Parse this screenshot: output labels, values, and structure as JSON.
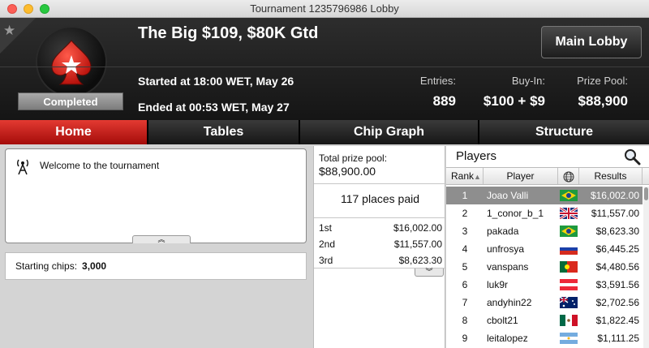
{
  "window": {
    "title": "Tournament 1235796986 Lobby"
  },
  "header": {
    "tournament_name": "The Big $109, $80K Gtd",
    "started": "Started at 18:00 WET, May 26",
    "ended": "Ended at 00:53 WET, May 27",
    "status": "Completed",
    "main_lobby": "Main Lobby",
    "entries": {
      "label": "Entries:",
      "value": "889"
    },
    "buyin": {
      "label": "Buy-In:",
      "value": "$100 + $9"
    },
    "prize_pool": {
      "label": "Prize Pool:",
      "value": "$88,900"
    }
  },
  "tabs": [
    "Home",
    "Tables",
    "Chip Graph",
    "Structure"
  ],
  "home": {
    "welcome": "Welcome to the tournament",
    "starting_chips_label": "Starting chips:",
    "starting_chips_value": "3,000"
  },
  "prize": {
    "total_label": "Total prize pool:",
    "total_value": "$88,900.00",
    "places_paid": "117 places paid",
    "payouts": [
      {
        "place": "1st",
        "amount": "$16,002.00"
      },
      {
        "place": "2nd",
        "amount": "$11,557.00"
      },
      {
        "place": "3rd",
        "amount": "$8,623.30"
      }
    ]
  },
  "players": {
    "title": "Players",
    "columns": {
      "rank": "Rank",
      "name": "Player",
      "results": "Results"
    },
    "rows": [
      {
        "rank": "1",
        "name": "Joao Valli",
        "flag": "brazil",
        "result": "$16,002.00"
      },
      {
        "rank": "2",
        "name": "1_conor_b_1",
        "flag": "uk",
        "result": "$11,557.00"
      },
      {
        "rank": "3",
        "name": "pakada",
        "flag": "brazil",
        "result": "$8,623.30"
      },
      {
        "rank": "4",
        "name": "unfrosya",
        "flag": "russia",
        "result": "$6,445.25"
      },
      {
        "rank": "5",
        "name": "vanspans",
        "flag": "portugal",
        "result": "$4,480.56"
      },
      {
        "rank": "6",
        "name": "luk9r",
        "flag": "austria",
        "result": "$3,591.56"
      },
      {
        "rank": "7",
        "name": "andyhin22",
        "flag": "australia",
        "result": "$2,702.56"
      },
      {
        "rank": "8",
        "name": "cbolt21",
        "flag": "mexico",
        "result": "$1,822.45"
      },
      {
        "rank": "9",
        "name": "leitalopez",
        "flag": "argentina",
        "result": "$1,111.25"
      }
    ]
  },
  "colors": {
    "accent_red": "#c21a16",
    "selected_row": "#8e8e8e"
  }
}
